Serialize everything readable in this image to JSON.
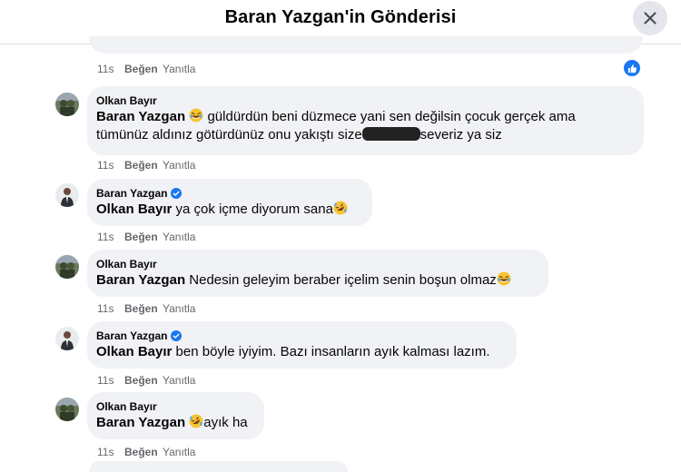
{
  "header": {
    "title": "Baran Yazgan'in Gönderisi"
  },
  "prev_actions": {
    "time": "11s",
    "like": "Beğen",
    "reply": "Yanıtla"
  },
  "comments": [
    {
      "author": "Olkan Bayır",
      "verified": false,
      "mention": "Baran Yazgan",
      "line1": "güldürdün beni düzmece yani sen değilsin çocuk gerçek ama",
      "line2a": "tümünüz aldınız götürdünüz onu yakıştı size",
      "line2b": "severiz ya siz",
      "time": "11s",
      "like": "Beğen",
      "reply": "Yanıtla"
    },
    {
      "author": "Baran Yazgan",
      "verified": true,
      "mention": "Olkan Bayır",
      "text": "ya çok içme diyorum sana",
      "time": "11s",
      "like": "Beğen",
      "reply": "Yanıtla"
    },
    {
      "author": "Olkan Bayır",
      "verified": false,
      "mention": "Baran Yazgan",
      "text": "Nedesin geleyim beraber içelim senin boşun olmaz",
      "time": "11s",
      "like": "Beğen",
      "reply": "Yanıtla"
    },
    {
      "author": "Baran Yazgan",
      "verified": true,
      "mention": "Olkan Bayır",
      "text": "ben böyle iyiyim. Bazı insanların ayık kalması lazım.",
      "time": "11s",
      "like": "Beğen",
      "reply": "Yanıtla"
    },
    {
      "author": "Olkan Bayır",
      "verified": false,
      "mention": "Baran Yazgan",
      "text": "ayık ha",
      "time": "11s",
      "like": "Beğen",
      "reply": "Yanıtla"
    }
  ],
  "icons": {
    "close": "close-icon",
    "like_reaction": "like-reaction-icon",
    "verified": "verified-badge-icon",
    "laugh": "laughing-emoji-icon"
  },
  "colors": {
    "accent": "#1877f2",
    "bubble": "#f0f2f5",
    "meta": "#65676b"
  }
}
